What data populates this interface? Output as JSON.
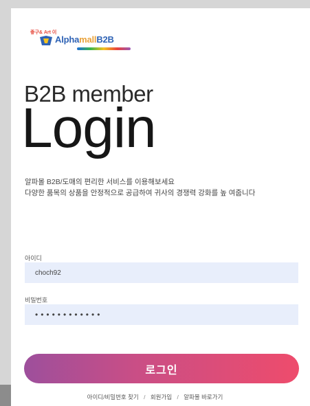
{
  "logo": {
    "tagline": "좋구& Art 이",
    "brand_alpha": "Alpha",
    "brand_mall": "mall",
    "brand_b2b": "B2B"
  },
  "header": {
    "subtitle": "B2B member",
    "title": "Login"
  },
  "description": {
    "line1": "알파몰 B2B/도매의 편리한 서비스를 이용해보세요",
    "line2": "다양한 품목의 상품을 안정적으로 공급하여 귀사의 경쟁력 강화를 높 여줍니다"
  },
  "form": {
    "id_label": "아이디",
    "id_value": "choch92",
    "password_label": "비밀번호",
    "password_value": "••••••••••••"
  },
  "actions": {
    "login_label": "로그인"
  },
  "footer": {
    "find_account": "아이디/비밀번호 찾기",
    "separator": "/",
    "signup": "회원가입",
    "go_to_alpha": "알파몰 바로가기"
  },
  "colors": {
    "button_gradient_start": "#9d4f9c",
    "button_gradient_end": "#ee4c6c",
    "field_bg": "#e8eefb",
    "brand_blue": "#2f63b5"
  }
}
